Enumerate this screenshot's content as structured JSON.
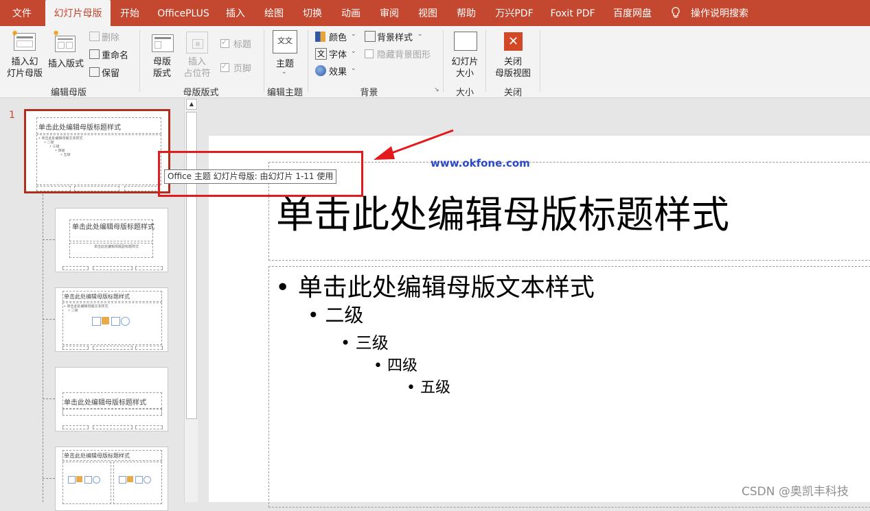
{
  "tabs": [
    {
      "label": "文件"
    },
    {
      "label": "幻灯片母版"
    },
    {
      "label": "开始"
    },
    {
      "label": "OfficePLUS"
    },
    {
      "label": "插入"
    },
    {
      "label": "绘图"
    },
    {
      "label": "切换"
    },
    {
      "label": "动画"
    },
    {
      "label": "审阅"
    },
    {
      "label": "视图"
    },
    {
      "label": "帮助"
    },
    {
      "label": "万兴PDF"
    },
    {
      "label": "Foxit PDF"
    },
    {
      "label": "百度网盘"
    }
  ],
  "search": {
    "label": "操作说明搜索"
  },
  "ribbon": {
    "edit_master": {
      "insert_master": "插入幻\n灯片母版",
      "insert_layout": "插入版式",
      "delete": "删除",
      "rename": "重命名",
      "preserve": "保留",
      "group": "编辑母版"
    },
    "master_layout": {
      "master_layout": "母版\n版式",
      "insert_placeholder": "插入\n占位符",
      "title": "标题",
      "footer": "页脚",
      "group": "母版版式"
    },
    "edit_theme": {
      "themes": "主题",
      "group": "编辑主题"
    },
    "background": {
      "colors": "颜色",
      "fonts": "字体",
      "effects": "效果",
      "background_styles": "背景样式",
      "hide_bg": "隐藏背景图形",
      "group": "背景"
    },
    "size": {
      "slide_size": "幻灯片\n大小",
      "group": "大小"
    },
    "close": {
      "close_master": "关闭\n母版视图",
      "group": "关闭"
    }
  },
  "thumbs": {
    "slide_number": "1",
    "master_title": "单击此处编辑母版标题样式",
    "master_text": "• 单击此处编辑母版文本样式",
    "level2": "• 二级",
    "level3": "• 三级",
    "level4": "• 四级",
    "level5": "• 五级",
    "layout2_title": "单击此处编辑母版标题样式",
    "layout2_sub": "单击此处编辑母版副标题样式",
    "layout3_title": "单击此处编辑母版标题样式",
    "layout4_title": "单击此处编辑母版标题样式",
    "layout5_title": "单击此处编辑母版标题样式"
  },
  "tooltip": "Office 主题 幻灯片母版: 由幻灯片 1-11 使用",
  "watermark_url": "www.okfone.com",
  "slide": {
    "title": "单击此处编辑母版标题样式",
    "level1": "单击此处编辑母版文本样式",
    "level2": "二级",
    "level3": "三级",
    "level4": "四级",
    "level5": "五级"
  },
  "csdn_watermark": "CSDN @奥凯丰科技",
  "colors": {
    "accent": "#c4472f",
    "annotation": "#e3191c",
    "link": "#2c49c8"
  }
}
